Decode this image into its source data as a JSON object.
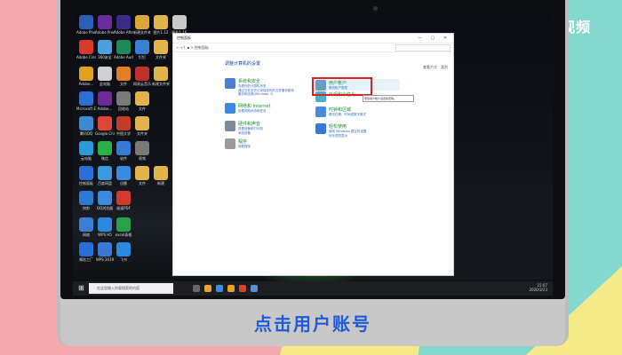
{
  "brand": {
    "logo_text": "天奇·视频"
  },
  "caption": "点击用户账号",
  "window": {
    "title": "控制面板",
    "address": "控制面板",
    "adjust_settings": "调整计算机的设置",
    "view_by": "查看方式：类别"
  },
  "categories": [
    {
      "title": "系统和安全",
      "subs": [
        "查看你的计算机状态",
        "通过文件历史记录保存你的文件备份副本",
        "备份和还原(Windows 7)"
      ]
    },
    {
      "title": "网络和 Internet",
      "subs": [
        "查看网络状态和任务"
      ]
    },
    {
      "title": "硬件和声音",
      "subs": [
        "查看设备和打印机",
        "添加设备"
      ]
    },
    {
      "title": "程序",
      "subs": [
        "卸载程序"
      ]
    },
    {
      "title": "用户帐户",
      "subs": [
        "更改帐户类型"
      ]
    },
    {
      "title": "外观和个性化",
      "subs": []
    },
    {
      "title": "时钟和区域",
      "subs": [
        "更改日期、时间或数字格式"
      ]
    },
    {
      "title": "轻松使用",
      "subs": [
        "使用 Windows 建议的设置",
        "优化视觉显示"
      ]
    }
  ],
  "tooltip": "更改用户帐户设置和密码。",
  "desktop_icons": [
    "Adobe Photosh...",
    "Adobe Premiere P...",
    "Adobe After Effects CC...",
    "新建文件夹",
    "图片1.12",
    "图片1.16",
    "Adobe Creati...",
    "360安全",
    "Adobe Audition",
    "钉钉",
    "文件夹",
    "Adobe...",
    "此电脑",
    "文件",
    "网易云音乐",
    "新建文件夹",
    "Microsoft Edge",
    "Adobe...",
    "回收站",
    "文件",
    "腾讯QQ",
    "Google Chrome",
    "中国大学",
    "文件夹",
    "云电脑",
    "微信",
    "软件",
    "视频",
    "控制面板",
    "百度网盘",
    "迅雷",
    "文件",
    "新建",
    "快剪",
    "QQ浏览器",
    "极速PDF",
    "网络",
    "WPS H5",
    "excel表格",
    "嘀咕工厂",
    "WPS 2019",
    "飞书"
  ],
  "taskbar": {
    "search_placeholder": "在这里输入你要搜索的内容",
    "time": "15:07",
    "date": "2020/3/23"
  },
  "colors": {
    "accent": "#1e8d3a",
    "link": "#3a6bc4",
    "highlight": "#e02020"
  }
}
